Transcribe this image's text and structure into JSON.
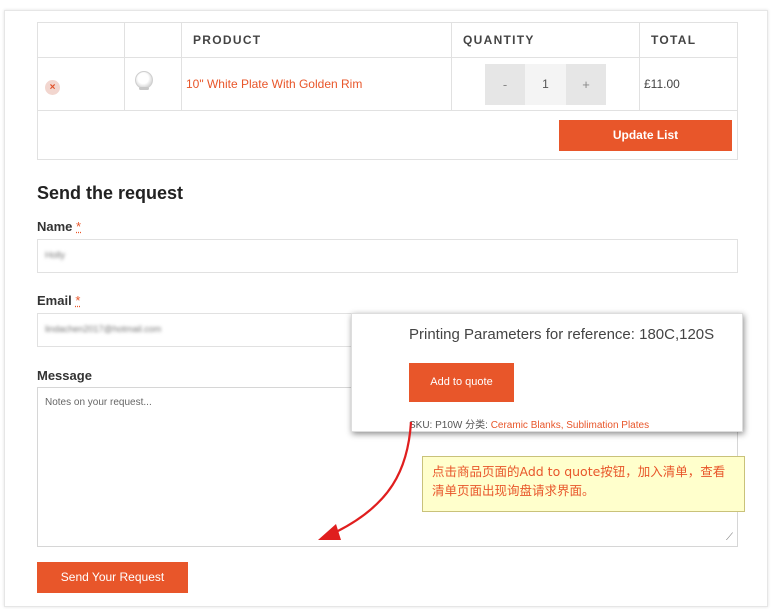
{
  "table": {
    "headers": {
      "product": "PRODUCT",
      "quantity": "QUANTITY",
      "total": "TOTAL"
    },
    "row": {
      "remove_icon": "×",
      "product_name": "10\" White Plate With Golden Rim",
      "quantity": "1",
      "decrement": "-",
      "increment": "+",
      "total": "£11.00"
    },
    "update_label": "Update List"
  },
  "form": {
    "heading": "Send the request",
    "name_label": "Name",
    "email_label": "Email",
    "required_mark": "*",
    "name_value": "Holly",
    "email_value": "lindachen2017@hotmail.com",
    "message_label": "Message",
    "message_placeholder": "Notes on your request...",
    "submit_label": "Send Your Request"
  },
  "popup": {
    "title": "Printing Parameters for reference: 180C,120S",
    "add_to_quote_label": "Add to quote",
    "sku_text": "SKU:  P10W  分类:",
    "categories": "Ceramic Blanks, Sublimation Plates"
  },
  "annotation": {
    "note": "点击商品页面的Add to quote按钮，加入清单，查看清单页面出现询盘请求界面。"
  },
  "colors": {
    "accent": "#e8562a",
    "note_bg": "#ffffcc",
    "arrow": "#e01e1e"
  }
}
